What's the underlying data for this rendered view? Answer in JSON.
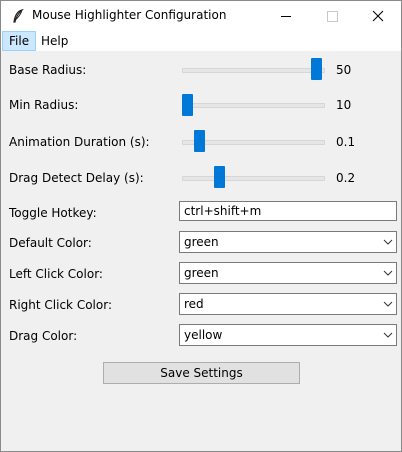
{
  "window": {
    "title": "Mouse Highlighter Configuration"
  },
  "menubar": {
    "items": [
      {
        "label": "File",
        "active": true
      },
      {
        "label": "Help",
        "active": false
      }
    ]
  },
  "sliders": [
    {
      "label": "Base Radius:",
      "value": "50"
    },
    {
      "label": "Min Radius:",
      "value": "10"
    },
    {
      "label": "Animation Duration (s):",
      "value": "0.1"
    },
    {
      "label": "Drag Detect Delay (s):",
      "value": "0.2"
    }
  ],
  "hotkey": {
    "label": "Toggle Hotkey:",
    "value": "ctrl+shift+m"
  },
  "colors": [
    {
      "label": "Default Color:",
      "value": "green"
    },
    {
      "label": "Left Click Color:",
      "value": "green"
    },
    {
      "label": "Right Click Color:",
      "value": "red"
    },
    {
      "label": "Drag Color:",
      "value": "yellow"
    }
  ],
  "save_label": "Save Settings",
  "accent_color": "#0078d7",
  "menu_highlight_color": "#cce8ff"
}
